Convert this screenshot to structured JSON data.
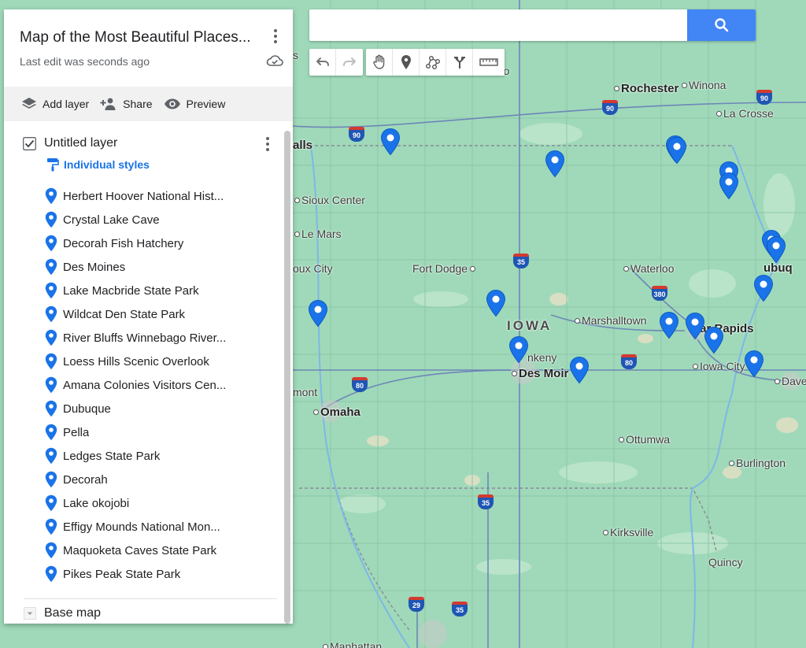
{
  "map_title": "Map of the Most Beautiful Places...",
  "last_edit": "Last edit was seconds ago",
  "actions": {
    "add_layer": "Add layer",
    "share": "Share",
    "preview": "Preview"
  },
  "layer": {
    "name": "Untitled layer",
    "styles_label": "Individual styles",
    "places": [
      "Herbert Hoover National Hist...",
      "Crystal Lake Cave",
      "Decorah Fish Hatchery",
      "Des Moines",
      "Lake Macbride State Park",
      "Wildcat Den State Park",
      "River Bluffs Winnebago River...",
      "Loess Hills Scenic Overlook",
      "Amana Colonies Visitors Cen...",
      "Dubuque",
      "Pella",
      "Ledges State Park",
      "Decorah",
      "Lake okojobi",
      "Effigy Mounds National Mon...",
      "Maquoketa Caves State Park",
      "Pikes Peak State Park"
    ]
  },
  "base_map": "Base map",
  "search": {
    "value": "",
    "placeholder": ""
  },
  "map_labels": {
    "rochester": "Rochester",
    "winona": "Winona",
    "la_crosse": "La Crosse",
    "sioux_center": "Sioux Center",
    "le_mars": "Le Mars",
    "sioux_city": "oux City",
    "fort_dodge": "Fort Dodge",
    "waterloo": "Waterloo",
    "iowa": "IOWA",
    "marshalltown": "Marshalltown",
    "cedar_rapids": "dar Rapids",
    "ankeny": "nkeny",
    "des_moines": "Des Moir",
    "iowa_city": "Iowa City",
    "davenport": "Dave",
    "omaha": "Omaha",
    "ottumwa": "Ottumwa",
    "burlington": "Burlington",
    "kirksville": "Kirksville",
    "quincy": "Quincy",
    "manhattan": "Manhattan",
    "falls": "alls",
    "dubuque_edge": "ubuq",
    "mont": "mont",
    "nto": "nto",
    "rs": "s"
  },
  "shields": [
    "90",
    "90",
    "90",
    "35",
    "380",
    "80",
    "80",
    "35",
    "29",
    "35"
  ],
  "colors": {
    "map_bg": "#9fd9b9",
    "accent": "#4285f4",
    "pin": "#1a73e8",
    "link": "#1a73e8"
  },
  "icons": {
    "search": "search-icon",
    "undo": "undo-icon",
    "redo": "redo-icon",
    "hand": "hand-icon",
    "marker": "add-marker-icon",
    "line": "draw-line-icon",
    "directions": "directions-icon",
    "ruler": "ruler-icon"
  }
}
